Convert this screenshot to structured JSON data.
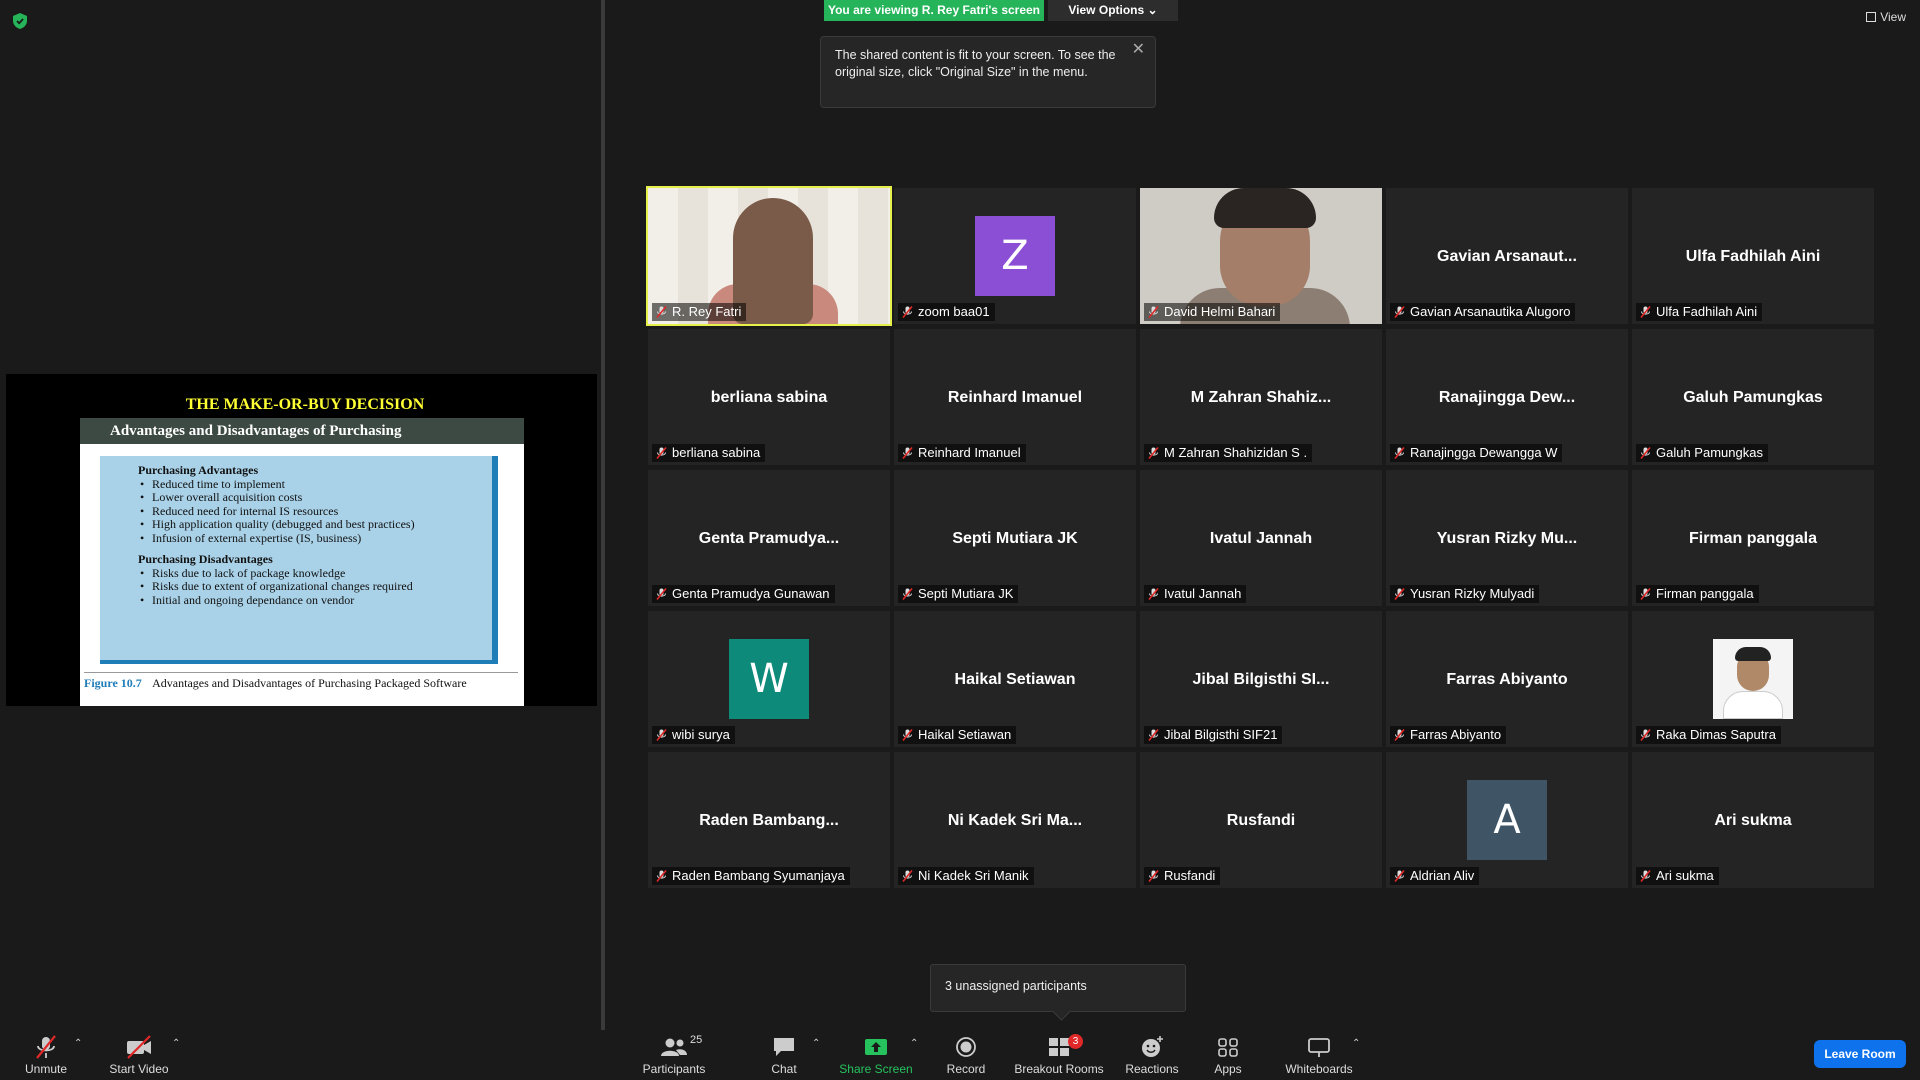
{
  "banner": {
    "viewing_text": "You are viewing R. Rey Fatri's screen",
    "view_options_label": "View Options",
    "top_view_label": "View"
  },
  "tooltip": {
    "text": "The shared content is fit to your screen. To see the original size, click \"Original Size\" in the menu."
  },
  "slide": {
    "title": "THE MAKE-OR-BUY DECISION",
    "header": "Advantages and Disadvantages of Purchasing",
    "adv_heading": "Purchasing Advantages",
    "adv_items": [
      "Reduced time to implement",
      "Lower overall acquisition costs",
      "Reduced need for internal IS resources",
      "High application quality (debugged and best practices)",
      "Infusion of external expertise (IS, business)"
    ],
    "dis_heading": "Purchasing Disadvantages",
    "dis_items": [
      "Risks due to lack of package knowledge",
      "Risks due to extent of organizational changes required",
      "Initial and ongoing dependance on vendor"
    ],
    "figure_label": "Figure 10.7",
    "caption": "Advantages and Disadvantages of Purchasing Packaged Software"
  },
  "participants": [
    {
      "big": "",
      "label": "R. Rey Fatri",
      "type": "video-rey"
    },
    {
      "big": "",
      "label": "zoom baa01",
      "type": "avatar",
      "letter": "Z",
      "color": "#8b4fd6"
    },
    {
      "big": "",
      "label": "David Helmi Bahari",
      "type": "video-david"
    },
    {
      "big": "Gavian  Arsanaut...",
      "label": "Gavian Arsanautika Alugoro",
      "type": "name"
    },
    {
      "big": "Ulfa Fadhilah Aini",
      "label": "Ulfa Fadhilah Aini",
      "type": "name"
    },
    {
      "big": "berliana sabina",
      "label": "berliana sabina",
      "type": "name"
    },
    {
      "big": "Reinhard Imanuel",
      "label": "Reinhard Imanuel",
      "type": "name"
    },
    {
      "big": "M  Zahran  Shahiz...",
      "label": "M Zahran Shahizidan S .",
      "type": "name"
    },
    {
      "big": "Ranajingga  Dew...",
      "label": "Ranajingga Dewangga W",
      "type": "name"
    },
    {
      "big": "Galuh Pamungkas",
      "label": "Galuh Pamungkas",
      "type": "name"
    },
    {
      "big": "Genta  Pramudya...",
      "label": "Genta Pramudya Gunawan",
      "type": "name"
    },
    {
      "big": "Septi Mutiara JK",
      "label": "Septi Mutiara JK",
      "type": "name"
    },
    {
      "big": "Ivatul Jannah",
      "label": "Ivatul Jannah",
      "type": "name"
    },
    {
      "big": "Yusran  Rizky  Mu...",
      "label": "Yusran Rizky Mulyadi",
      "type": "name"
    },
    {
      "big": "Firman panggala",
      "label": "Firman panggala",
      "type": "name"
    },
    {
      "big": "",
      "label": "wibi surya",
      "type": "avatar",
      "letter": "W",
      "color": "#0e8a7a"
    },
    {
      "big": "Haikal Setiawan",
      "label": "Haikal Setiawan",
      "type": "name"
    },
    {
      "big": "Jibal  Bilgisthi  SI...",
      "label": "Jibal Bilgisthi SIF21",
      "type": "name"
    },
    {
      "big": "Farras Abiyanto",
      "label": "Farras Abiyanto",
      "type": "name"
    },
    {
      "big": "",
      "label": "Raka Dimas Saputra",
      "type": "photo-raka"
    },
    {
      "big": "Raden  Bambang...",
      "label": "Raden Bambang Syumanjaya",
      "type": "name"
    },
    {
      "big": "Ni Kadek Sri Ma...",
      "label": "Ni Kadek Sri Manik",
      "type": "name"
    },
    {
      "big": "Rusfandi",
      "label": "Rusfandi",
      "type": "name"
    },
    {
      "big": "",
      "label": "Aldrian Aliv",
      "type": "avatar",
      "letter": "A",
      "color": "#3f5566"
    },
    {
      "big": "Ari sukma",
      "label": "Ari sukma",
      "type": "name"
    }
  ],
  "unassigned": {
    "text": "3 unassigned participants"
  },
  "toolbar": {
    "unmute": "Unmute",
    "start_video": "Start Video",
    "participants": "Participants",
    "participants_count": "25",
    "chat": "Chat",
    "share_screen": "Share Screen",
    "record": "Record",
    "breakout_rooms": "Breakout Rooms",
    "breakout_badge": "3",
    "reactions": "Reactions",
    "apps": "Apps",
    "whiteboards": "Whiteboards",
    "leave_room": "Leave Room"
  },
  "colors": {
    "banner_green": "#26b45a",
    "active_speaker": "#e6f04a",
    "leave_blue": "#0e72ed",
    "muted_red": "#e02828"
  }
}
